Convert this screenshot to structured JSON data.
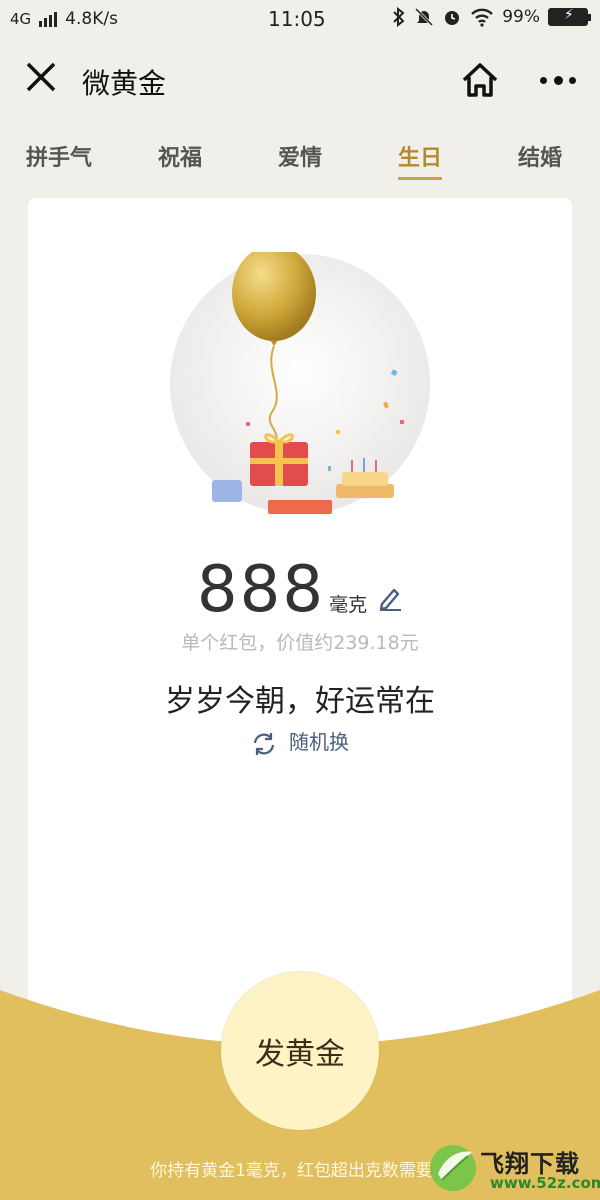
{
  "status_bar": {
    "network": "4G",
    "speed": "4.8K/s",
    "time": "11:05",
    "battery": "99%"
  },
  "nav": {
    "title": "微黄金",
    "close_icon": "close-icon",
    "home_icon": "home-icon",
    "more_icon": "more-icon"
  },
  "tabs": [
    {
      "label": "拼手气",
      "active": false
    },
    {
      "label": "祝福",
      "active": false
    },
    {
      "label": "爱情",
      "active": false
    },
    {
      "label": "生日",
      "active": true
    },
    {
      "label": "结婚",
      "active": false
    }
  ],
  "card": {
    "amount": "888",
    "unit": "毫克",
    "value_line": "单个红包，价值约239.18元",
    "greeting": "岁岁今朝，好运常在",
    "random_label": "随机换"
  },
  "send_button": "发黄金",
  "bottom_note": "你持有黄金1毫克，红包超出克数需要现",
  "watermark": {
    "text": "飞翔下载",
    "url": "www.52z.com"
  },
  "colors": {
    "accent": "#c9a343",
    "gold_bg": "#e2bf5e",
    "active_tab": "#b48a2c",
    "send_button_bg": "#fdf3c4"
  }
}
